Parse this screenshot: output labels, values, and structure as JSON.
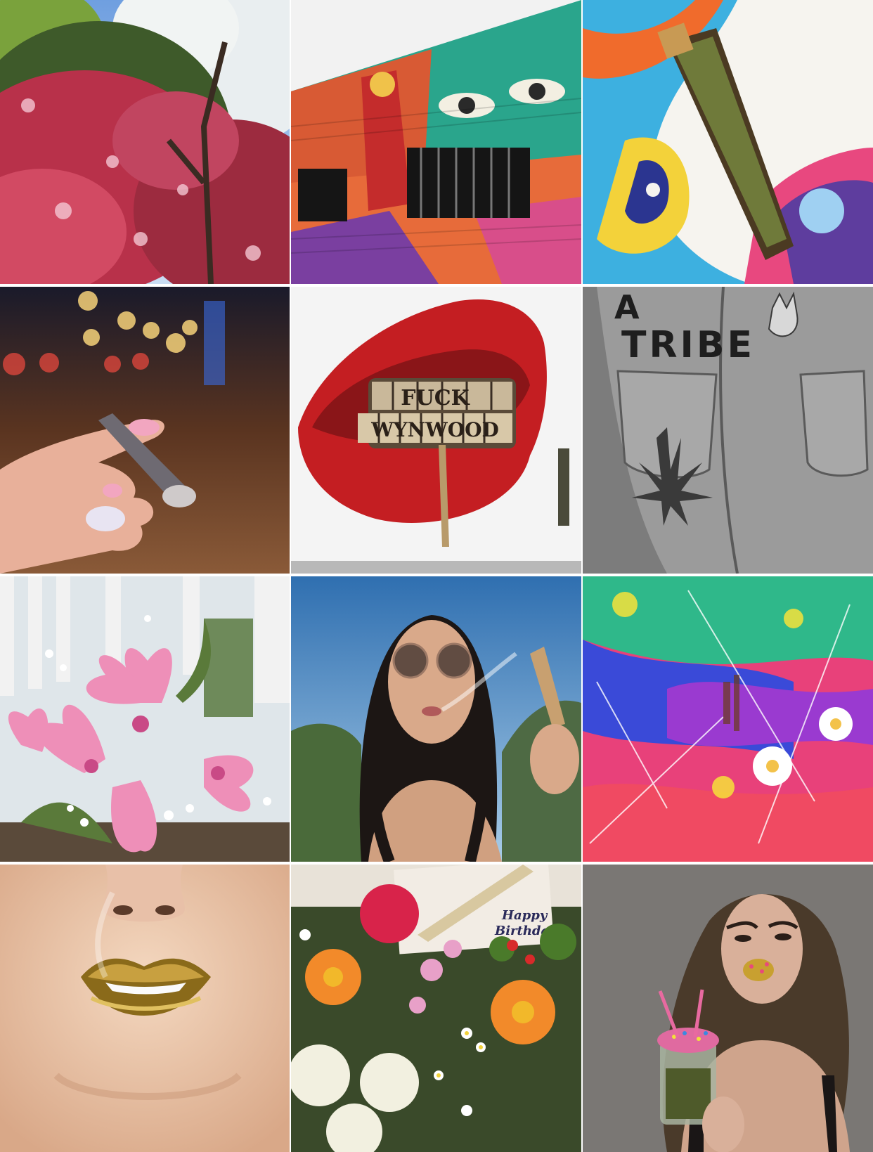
{
  "grid": {
    "tiles": [
      {
        "subject": "flowering-trees"
      },
      {
        "subject": "street-mural-building"
      },
      {
        "subject": "joint-on-psychedelic-art"
      },
      {
        "subject": "hand-holding-joint-night"
      },
      {
        "subject": "lips-mural",
        "lettering": [
          "FUCK",
          "WYNWOOD"
        ]
      },
      {
        "subject": "jeans-back-patches",
        "lettering": [
          "A",
          "TRIBE"
        ]
      },
      {
        "subject": "pink-lilies-bouquet"
      },
      {
        "subject": "woman-sunglasses-smoking"
      },
      {
        "subject": "colorful-collage-art"
      },
      {
        "subject": "gold-lips-smoke"
      },
      {
        "subject": "birthday-flowers-card",
        "lettering": [
          "Happy",
          "Birthday"
        ]
      },
      {
        "subject": "woman-jar-portrait"
      }
    ]
  }
}
